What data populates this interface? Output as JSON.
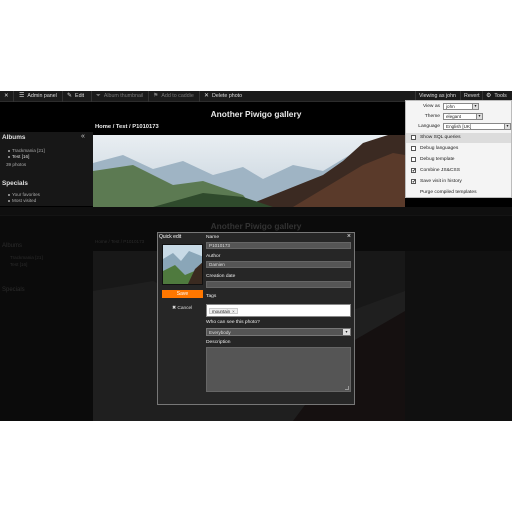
{
  "admin_bar": {
    "close_label": "✕",
    "admin_panel": "Admin panel",
    "edit": "Edit",
    "album_thumbnail": "Album thumbnail",
    "add_to_caddie": "Add to caddie",
    "delete_photo": "Delete photo",
    "viewing_as": "Viewing as john",
    "revert": "Revert",
    "tools": "Tools"
  },
  "gallery_title": "Another Piwigo gallery",
  "breadcrumb": "Home / Test / P1010173",
  "sidebar": {
    "albums_heading": "Albums",
    "album_1": "Trackmania [21]",
    "album_2": "Test [16]",
    "photos_count": "39 photos",
    "specials_heading": "Specials",
    "special_1": "Your favorites",
    "special_2": "Most visited"
  },
  "tools_menu": {
    "view_as_label": "View as",
    "view_as_value": "john",
    "theme_label": "Theme",
    "theme_value": "elegant",
    "language_label": "Language",
    "language_value": "English [UK]",
    "items": [
      {
        "label": "Show SQL queries",
        "checked": false
      },
      {
        "label": "Debug languages",
        "checked": false
      },
      {
        "label": "Debug template",
        "checked": false
      },
      {
        "label": "Combine JS&CSS",
        "checked": true
      },
      {
        "label": "Save visit in history",
        "checked": true
      },
      {
        "label": "Purge compiled templates",
        "checked": null
      }
    ]
  },
  "quick_edit": {
    "title": "Quick edit",
    "close": "×",
    "name_label": "Name",
    "name_value": "P1010173",
    "author_label": "Author",
    "author_value": "Damien",
    "creation_date_label": "Creation date",
    "creation_date_value": "",
    "tags_label": "Tags",
    "tag_1": "mountain",
    "tag_remove": "×",
    "visibility_label": "Who can see this photo?",
    "visibility_value": "Everybody",
    "description_label": "Description",
    "save_label": "Save",
    "cancel_label": "Cancel"
  },
  "colors": {
    "accent": "#ff7700",
    "background": "#000000",
    "menu_bg": "#f4f4f4"
  }
}
